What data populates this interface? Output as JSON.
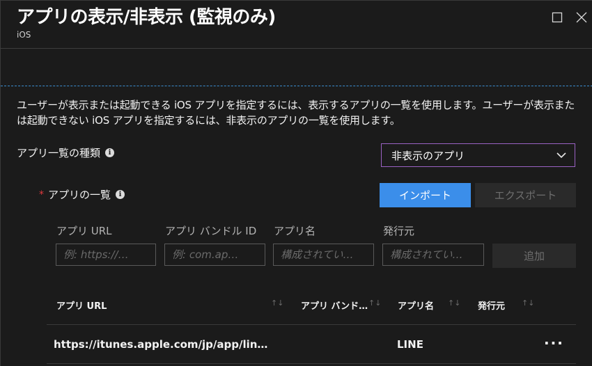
{
  "header": {
    "title": "アプリの表示/非表示 (監視のみ)",
    "subtitle": "iOS"
  },
  "description": "ユーザーが表示または起動できる iOS アプリを指定するには、表示するアプリの一覧を使用します。ユーザーが表示または起動できない iOS アプリを指定するには、非表示のアプリの一覧を使用します。",
  "list_type": {
    "label": "アプリ一覧の種類",
    "selected": "非表示のアプリ"
  },
  "app_list": {
    "label": "アプリの一覧",
    "required_mark": "*",
    "import_label": "インポート",
    "export_label": "エクスポート"
  },
  "form": {
    "url_label": "アプリ URL",
    "url_placeholder": "例: https://…",
    "bundle_label": "アプリ バンドル ID",
    "bundle_placeholder": "例: com.ap…",
    "name_label": "アプリ名",
    "name_placeholder": "構成されてい…",
    "publisher_label": "発行元",
    "publisher_placeholder": "構成されてい…",
    "add_label": "追加"
  },
  "table": {
    "columns": [
      "アプリ URL",
      "アプリ バンド…",
      "アプリ名",
      "発行元"
    ],
    "sort_glyph": "↑↓",
    "rows": [
      {
        "url": "https://itunes.apple.com/jp/app/lin…",
        "bundle": "",
        "name": "LINE",
        "publisher": "",
        "more": "···"
      }
    ]
  },
  "colors": {
    "background": "#1b1b1b",
    "accent": "#3b8eea",
    "dropdown_border": "#9b62c4",
    "required": "#e0393e"
  }
}
